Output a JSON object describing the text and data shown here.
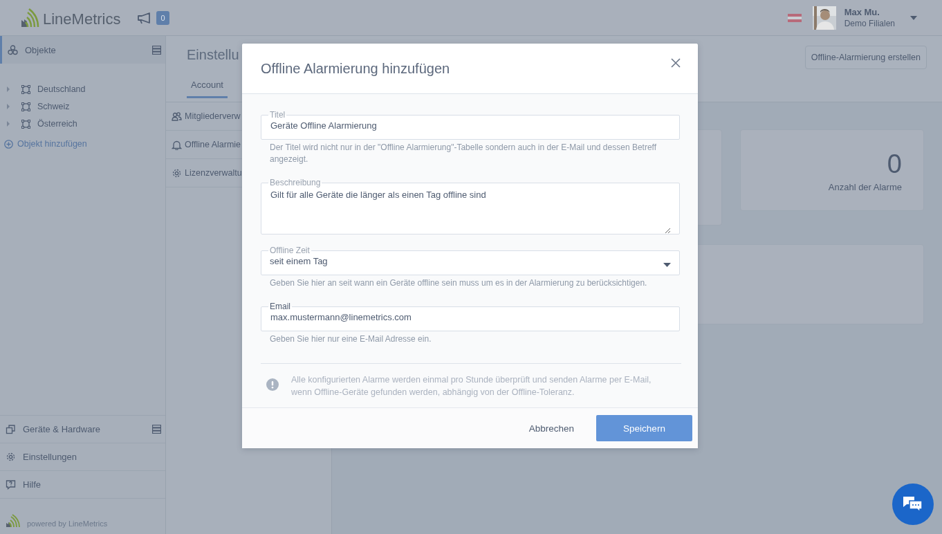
{
  "header": {
    "logo": "LineMetrics",
    "news_count": "0",
    "user": {
      "name": "Max Mu.",
      "org": "Demo Filialen"
    }
  },
  "sidebar": {
    "top_item": {
      "label": "Objekte",
      "selected": true
    },
    "tree": [
      {
        "label": "Deutschland",
        "expanded": false
      },
      {
        "label": "Schweiz",
        "expanded": false
      },
      {
        "label": "Österreich",
        "expanded": false
      }
    ],
    "add_link": "Objekt hinzufügen",
    "bottom_items": [
      {
        "label": "Geräte & Hardware",
        "kind": "devices"
      },
      {
        "label": "Einstellungen",
        "kind": "settings"
      },
      {
        "label": "Hilfe",
        "kind": "help"
      }
    ],
    "footer": "powered by LineMetrics"
  },
  "page": {
    "title": "Einstellu",
    "tabs": [
      {
        "label": "Account",
        "selected": true
      }
    ],
    "nav": [
      {
        "label": "Mitgliederverw",
        "kind": "members"
      },
      {
        "label": "Offline Alarmie",
        "kind": "bell"
      },
      {
        "label": "Lizenzverwaltu",
        "kind": "settings"
      }
    ],
    "create_button": "Offline-Alarmierung erstellen",
    "stat_card": {
      "value": "0",
      "label": "Anzahl der Alarme"
    }
  },
  "dialog": {
    "title": "Offline Alarmierung hinzufügen",
    "fields": [
      {
        "kind": "text",
        "label": "Titel",
        "value": "Geräte Offline Alarmierung",
        "focused": false,
        "help": "Der Titel wird nicht nur in der \"Offline Alarmierung\"-Tabelle sondern auch in der E-Mail und dessen Betreff angezeigt."
      },
      {
        "kind": "textarea",
        "label": "Beschreibung",
        "value": "Gilt für alle Geräte die länger als einen Tag offline sind",
        "focused": false
      },
      {
        "kind": "select",
        "label": "Offline Zeit",
        "value": "seit einem Tag",
        "focused": false,
        "help": "Geben Sie hier an seit wann ein Geräte offline sein muss um es in der Alarmierung zu berücksichtigen."
      },
      {
        "kind": "text",
        "label": "Email",
        "value": "max.mustermann@linemetrics.com",
        "focused": true,
        "help": "Geben Sie hier nur eine E-Mail Adresse ein."
      }
    ],
    "note": "Alle konfigurierten Alarme werden einmal pro Stunde überprüft und senden Alarme per E-Mail, wenn Offline-Geräte gefunden werden, abhängig von der Offline-Toleranz.",
    "buttons": [
      {
        "label": "Abbrechen",
        "kind": "secondary"
      },
      {
        "label": "Speichern",
        "kind": "primary"
      }
    ]
  }
}
